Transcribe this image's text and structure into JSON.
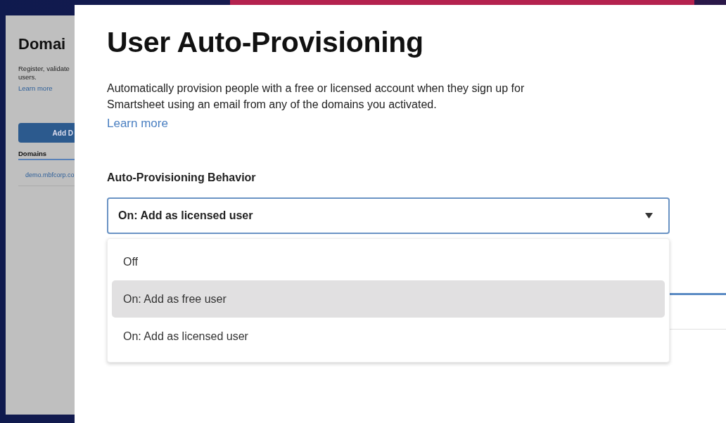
{
  "background_page": {
    "title": "Domai",
    "description": [
      "Register, validate",
      "users."
    ],
    "link": "Learn more",
    "button": "Add D",
    "tab": "Domains",
    "rows": [
      "demo.mbfcorp.co"
    ]
  },
  "panel": {
    "title": "User Auto-Provisioning",
    "description": "Automatically provision people with a free or licensed account when they sign up for Smartsheet using an email from any of the domains you activated.",
    "link": "Learn more",
    "field_label": "Auto-Provisioning Behavior",
    "dropdown": {
      "value": "On: Add as licensed user",
      "expanded": true,
      "options": [
        {
          "label": "Off",
          "highlighted": false
        },
        {
          "label": "On: Add as free user",
          "highlighted": true
        },
        {
          "label": "On: Add as licensed user",
          "highlighted": false
        }
      ]
    }
  }
}
